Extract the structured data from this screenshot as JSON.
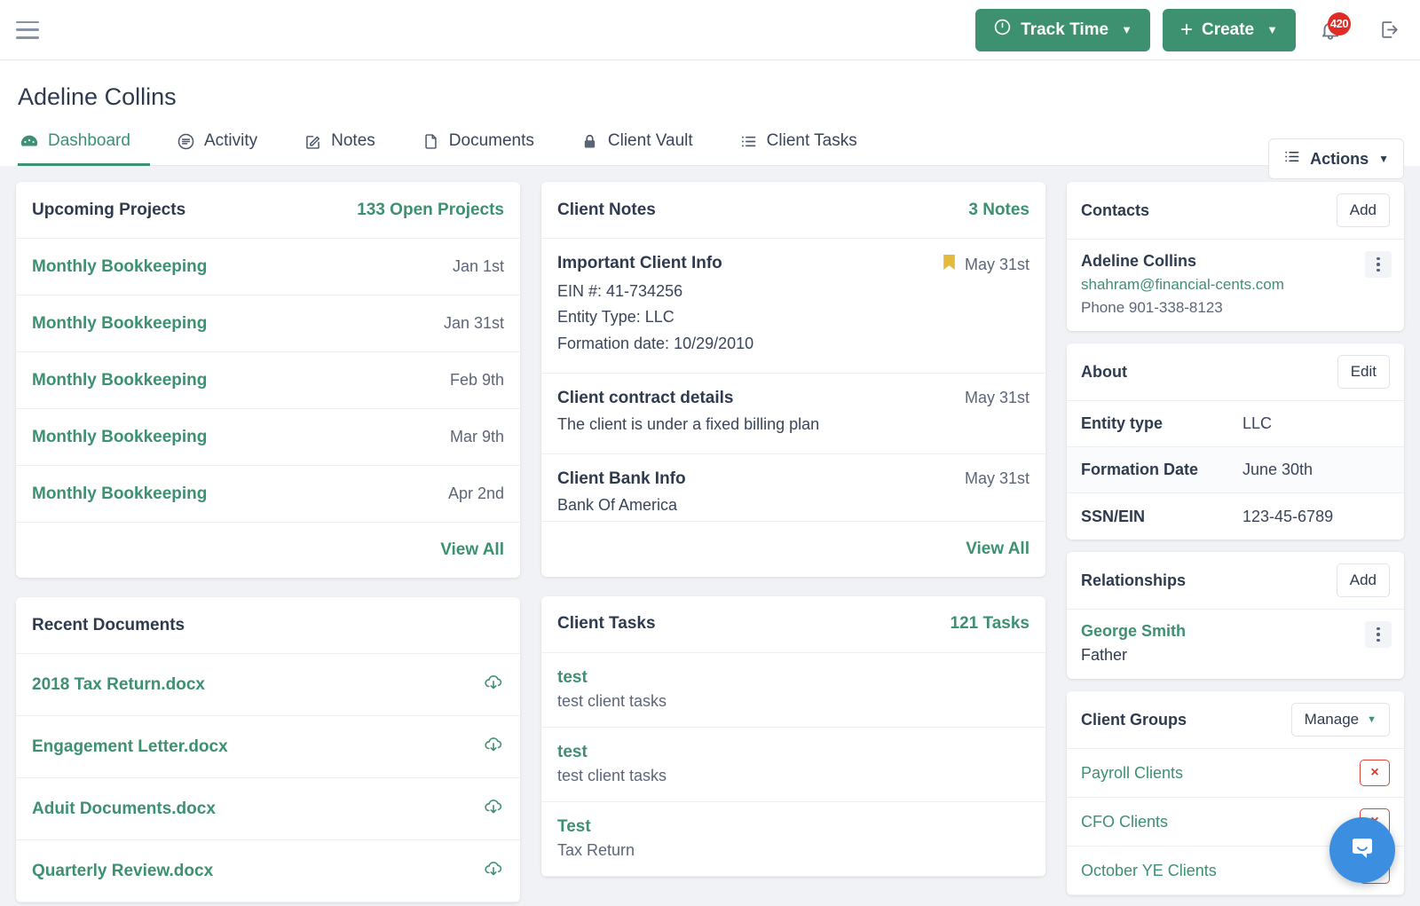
{
  "topbar": {
    "menu_icon": "hamburger-icon",
    "track_time_label": "Track Time",
    "create_label": "Create",
    "caret": "▼",
    "plus": "+",
    "notification_count": "420",
    "bell_icon": "bell-icon",
    "logout_icon": "logout-icon"
  },
  "page": {
    "title": "Adeline Collins",
    "actions_label": "Actions",
    "actions_caret": "▼"
  },
  "tabs": [
    {
      "label": "Dashboard",
      "icon": "dashboard-icon",
      "active": true
    },
    {
      "label": "Activity",
      "icon": "activity-icon",
      "active": false
    },
    {
      "label": "Notes",
      "icon": "notes-icon",
      "active": false
    },
    {
      "label": "Documents",
      "icon": "document-icon",
      "active": false
    },
    {
      "label": "Client Vault",
      "icon": "lock-icon",
      "active": false
    },
    {
      "label": "Client Tasks",
      "icon": "list-icon",
      "active": false
    }
  ],
  "upcoming_projects": {
    "title": "Upcoming Projects",
    "meta": "133 Open Projects",
    "view_all": "View All",
    "items": [
      {
        "name": "Monthly Bookkeeping",
        "date": "Jan 1st"
      },
      {
        "name": "Monthly Bookkeeping",
        "date": "Jan 31st"
      },
      {
        "name": "Monthly Bookkeeping",
        "date": "Feb 9th"
      },
      {
        "name": "Monthly Bookkeeping",
        "date": "Mar 9th"
      },
      {
        "name": "Monthly Bookkeeping",
        "date": "Apr 2nd"
      }
    ]
  },
  "recent_documents": {
    "title": "Recent Documents",
    "items": [
      {
        "name": "2018 Tax Return.docx",
        "action_icon": "download-cloud-icon"
      },
      {
        "name": "Engagement Letter.docx",
        "action_icon": "download-cloud-icon"
      },
      {
        "name": "Aduit Documents.docx",
        "action_icon": "download-cloud-icon"
      },
      {
        "name": "Quarterly Review.docx",
        "action_icon": "download-cloud-icon"
      }
    ]
  },
  "client_notes": {
    "title": "Client Notes",
    "meta": "3 Notes",
    "view_all": "View All",
    "items": [
      {
        "title": "Important Client Info",
        "date": "May 31st",
        "pinned": true,
        "lines": [
          "EIN #: 41-734256",
          "Entity Type: LLC",
          "Formation date: 10/29/2010"
        ]
      },
      {
        "title": "Client contract details",
        "date": "May 31st",
        "pinned": false,
        "lines": [
          "The client is under a fixed billing plan"
        ]
      },
      {
        "title": "Client Bank Info",
        "date": "May 31st",
        "pinned": false,
        "lines": [
          "Bank Of America"
        ]
      }
    ]
  },
  "client_tasks": {
    "title": "Client Tasks",
    "meta": "121 Tasks",
    "items": [
      {
        "title": "test",
        "subtitle": "test client tasks"
      },
      {
        "title": "test",
        "subtitle": "test client tasks"
      },
      {
        "title": "Test",
        "subtitle": "Tax Return"
      }
    ]
  },
  "contacts": {
    "title": "Contacts",
    "add_label": "Add",
    "person": {
      "name": "Adeline Collins",
      "email": "shahram@financial-cents.com",
      "phone": "Phone 901-338-8123"
    }
  },
  "about": {
    "title": "About",
    "edit_label": "Edit",
    "rows": [
      {
        "key": "Entity type",
        "value": "LLC"
      },
      {
        "key": "Formation Date",
        "value": "June 30th"
      },
      {
        "key": "SSN/EIN",
        "value": "123-45-6789"
      }
    ]
  },
  "relationships": {
    "title": "Relationships",
    "add_label": "Add",
    "person": {
      "name": "George Smith",
      "type": "Father"
    }
  },
  "client_groups": {
    "title": "Client Groups",
    "manage_label": "Manage",
    "manage_caret": "▼",
    "remove_glyph": "×",
    "items": [
      {
        "name": "Payroll Clients"
      },
      {
        "name": "CFO Clients"
      },
      {
        "name": "October YE Clients"
      }
    ]
  },
  "chat": {
    "icon": "chat-bubble-icon"
  },
  "colors": {
    "brand_green": "#3d9070",
    "danger_red": "#e0453c",
    "badge_red": "#e02c25",
    "chat_blue": "#3c8ee0",
    "pin_yellow": "#e5b93c",
    "text_dark": "#2e3b4e",
    "page_bg": "#f0f2f5"
  }
}
